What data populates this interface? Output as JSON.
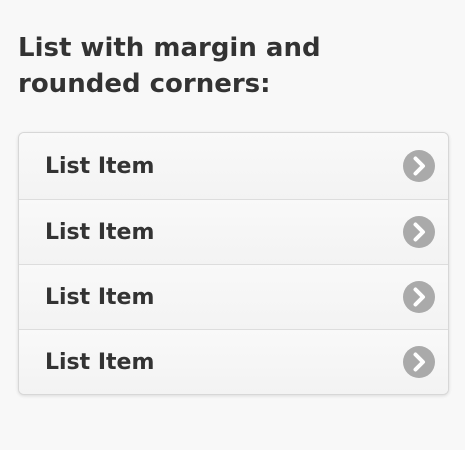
{
  "heading": "List with margin and rounded corners:",
  "list": {
    "items": [
      {
        "label": "List Item",
        "icon": "chevron-right-icon"
      },
      {
        "label": "List Item",
        "icon": "chevron-right-icon"
      },
      {
        "label": "List Item",
        "icon": "chevron-right-icon"
      },
      {
        "label": "List Item",
        "icon": "chevron-right-icon"
      }
    ]
  },
  "colors": {
    "background": "#f8f8f8",
    "text": "#333333",
    "icon": "#aaaaaa",
    "border": "#d7d7d7"
  }
}
